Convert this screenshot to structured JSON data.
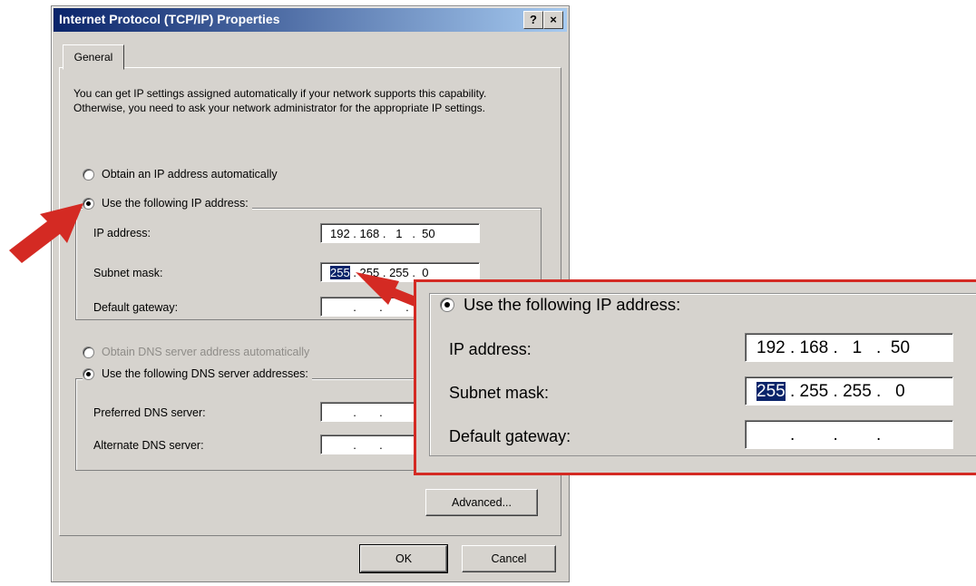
{
  "window": {
    "title": "Internet Protocol (TCP/IP) Properties",
    "help_button": "?",
    "close_button": "×"
  },
  "tabs": [
    "General"
  ],
  "intro_text": "You can get IP settings assigned automatically if your network supports this capability. Otherwise, you need to ask your network administrator for the appropriate IP settings.",
  "ip_mode": {
    "auto_label": "Obtain an IP address automatically",
    "manual_label": "Use the following IP address:",
    "selected": "manual"
  },
  "ip_fields": {
    "ip_label": "IP address:",
    "ip_value": "192 . 168 .   1   .  50",
    "subnet_label": "Subnet mask:",
    "subnet_selected": "255",
    "subnet_rest": " . 255 . 255 .  0",
    "gateway_label": "Default gateway:",
    "gateway_value": "       .       .       ."
  },
  "dns_mode": {
    "auto_label": "Obtain DNS server address automatically",
    "manual_label": "Use the following DNS server addresses:",
    "selected": "manual"
  },
  "dns_fields": {
    "preferred_label": "Preferred DNS server:",
    "preferred_value": "       .       .",
    "alternate_label": "Alternate DNS server:",
    "alternate_value": "       .       ."
  },
  "buttons": {
    "advanced": "Advanced...",
    "ok": "OK",
    "cancel": "Cancel"
  },
  "zoom": {
    "manual_label": "Use the following IP address:",
    "ip_label": "IP address:",
    "ip_value": "192 . 168 .   1   .  50",
    "subnet_label": "Subnet mask:",
    "subnet_selected": "255",
    "subnet_rest": " . 255 . 255 .   0",
    "gateway_label": "Default gateway:",
    "gateway_value": "       .        .        ."
  },
  "colors": {
    "arrow": "#d42a23",
    "callout_border": "#d42a23",
    "title_bar": "#0a246a",
    "dialog_bg": "#d6d3ce"
  }
}
